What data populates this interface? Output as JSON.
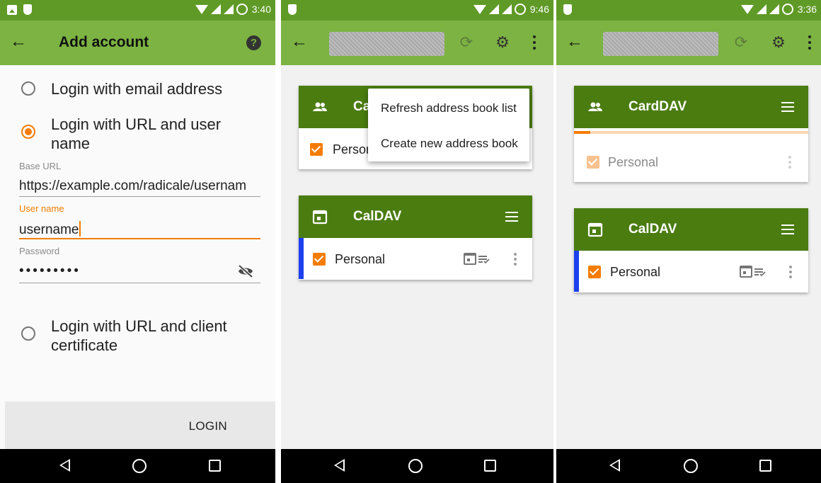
{
  "screens": [
    {
      "status": {
        "time": "3:40"
      },
      "appbar": {
        "title": "Add account"
      },
      "form": {
        "options": [
          {
            "label": "Login with email address",
            "selected": false
          },
          {
            "label": "Login with URL and user name",
            "selected": true
          },
          {
            "label": "Login with URL and client certificate",
            "selected": false
          }
        ],
        "base_url_label": "Base URL",
        "base_url_value": "https://example.com/radicale/usernam",
        "username_label": "User name",
        "username_value": "username",
        "password_label": "Password",
        "password_value": "•••••••••"
      },
      "login_button": "LOGIN"
    },
    {
      "status": {
        "time": "9:46"
      },
      "carddav_title": "Ca",
      "carddav_row": "Person",
      "caldav_title": "CalDAV",
      "caldav_row": "Personal",
      "menu": {
        "items": [
          "Refresh address book list",
          "Create new address book"
        ]
      }
    },
    {
      "status": {
        "time": "3:36"
      },
      "carddav_title": "CardDAV",
      "carddav_row": "Personal",
      "carddav_sync_progress": 0.07,
      "caldav_title": "CalDAV",
      "caldav_row": "Personal"
    }
  ],
  "colors": {
    "status_bar": "#5f9a26",
    "app_bar": "#7cb342",
    "card_header": "#4a7c10",
    "accent": "#f57c00",
    "calendar_color": "#1d3ff0"
  },
  "icons": [
    "back-arrow-icon",
    "help-icon",
    "sync-icon",
    "settings-gear-icon",
    "overflow-menu-icon",
    "contacts-icon",
    "calendar-icon",
    "menu-icon",
    "task-list-icon",
    "visibility-off-icon",
    "nav-back-icon",
    "nav-home-icon",
    "nav-recents-icon"
  ]
}
